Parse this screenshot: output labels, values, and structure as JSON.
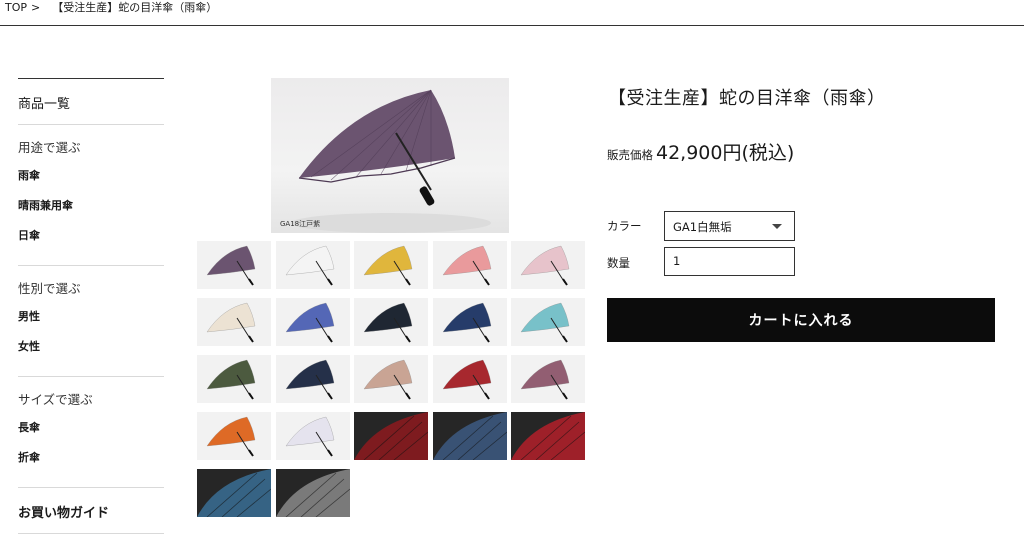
{
  "breadcrumb": {
    "home": "TOP",
    "separator": ">",
    "current": "【受注生産】蛇の目洋傘（雨傘）"
  },
  "sidebar": {
    "all_products": "商品一覧",
    "groups": [
      {
        "title": "用途で選ぶ",
        "items": [
          "雨傘",
          "晴雨兼用傘",
          "日傘"
        ]
      },
      {
        "title": "性別で選ぶ",
        "items": [
          "男性",
          "女性"
        ]
      },
      {
        "title": "サイズで選ぶ",
        "items": [
          "長傘",
          "折傘"
        ]
      }
    ],
    "guide": "お買い物ガイド"
  },
  "main_image": {
    "caption": "GA18江戸紫",
    "color": "#6b5470"
  },
  "thumbnails": [
    {
      "kind": "umbrella",
      "color": "#6b5470"
    },
    {
      "kind": "umbrella",
      "color": "#f4f4f4"
    },
    {
      "kind": "umbrella",
      "color": "#e0b63c"
    },
    {
      "kind": "umbrella",
      "color": "#e99a9c"
    },
    {
      "kind": "umbrella",
      "color": "#e7c3cb"
    },
    {
      "kind": "umbrella",
      "color": "#ece2d3"
    },
    {
      "kind": "umbrella",
      "color": "#5467b6"
    },
    {
      "kind": "umbrella",
      "color": "#1f2733"
    },
    {
      "kind": "umbrella",
      "color": "#263c6a"
    },
    {
      "kind": "umbrella",
      "color": "#78c1c9"
    },
    {
      "kind": "umbrella",
      "color": "#4c5a3f"
    },
    {
      "kind": "umbrella",
      "color": "#253049"
    },
    {
      "kind": "umbrella",
      "color": "#c9a494"
    },
    {
      "kind": "umbrella",
      "color": "#a7282e"
    },
    {
      "kind": "umbrella",
      "color": "#925e72"
    },
    {
      "kind": "umbrella",
      "color": "#de6a26"
    },
    {
      "kind": "umbrella",
      "color": "#e5e3ee"
    },
    {
      "kind": "photo",
      "color": "#8e1a1e"
    },
    {
      "kind": "photo",
      "color": "#3d5b83"
    },
    {
      "kind": "photo",
      "color": "#b4202a"
    },
    {
      "kind": "photo",
      "color": "#3a6e95"
    },
    {
      "kind": "photo",
      "color": "#8a8a8a"
    }
  ],
  "product": {
    "title": "【受注生産】蛇の目洋傘（雨傘）",
    "price_label": "販売価格",
    "price": "42,900円(税込)",
    "color_label": "カラー",
    "color_value": "GA1白無垢",
    "qty_label": "数量",
    "qty_value": "1",
    "cart_button": "カートに入れる"
  }
}
